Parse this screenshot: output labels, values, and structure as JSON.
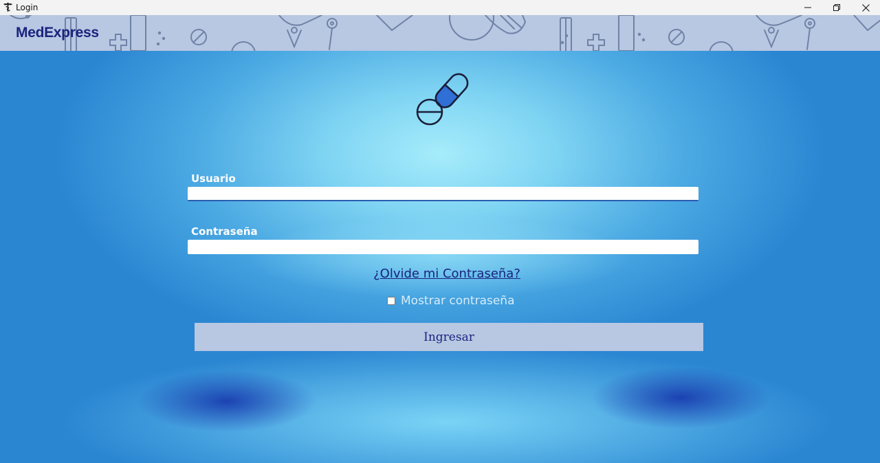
{
  "window": {
    "title": "Login",
    "icon": "caduceus-icon",
    "controls": [
      "minimize-icon",
      "restore-icon",
      "close-icon"
    ]
  },
  "header": {
    "brand": "MedExpress",
    "pattern": "medical-icons-pattern"
  },
  "logo": {
    "icon": "pills-icon",
    "colors": {
      "outline": "#1a1f3a",
      "fill": "#2f6fd6"
    }
  },
  "form": {
    "username": {
      "label": "Usuario",
      "value": "",
      "placeholder": ""
    },
    "password": {
      "label": "Contraseña",
      "value": "",
      "placeholder": ""
    },
    "forgot_link": "¿Olvide mi Contraseña?",
    "show_password": {
      "label": "Mostrar contraseña",
      "checked": false
    },
    "submit_label": "Ingresar"
  },
  "colors": {
    "brand": "#1a237e",
    "banner": "#b8c7e2",
    "button": "#b8c7e2",
    "background_center": "#a6ecfb",
    "background_edge": "#2a7fd0"
  }
}
